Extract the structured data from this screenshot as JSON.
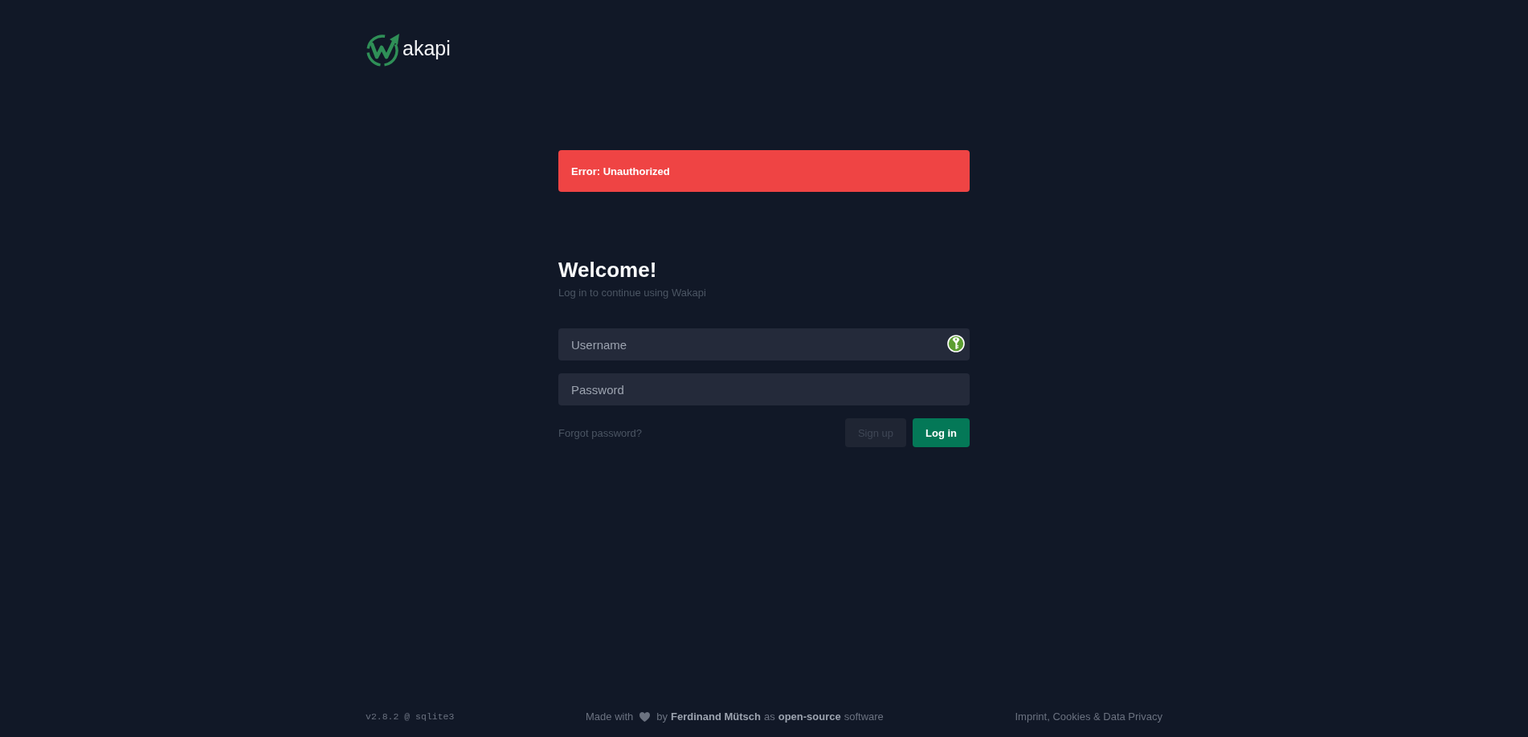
{
  "header": {
    "brand": "akapi"
  },
  "alert": {
    "kind": "error",
    "message": "Error: Unauthorized"
  },
  "login": {
    "title": "Welcome!",
    "subtitle": "Log in to continue using Wakapi",
    "fields": [
      {
        "placeholder": "Username",
        "autofill_icon": true
      },
      {
        "placeholder": "Password",
        "autofill_icon": false
      }
    ],
    "forgot_link": "Forgot password?",
    "buttons": [
      {
        "kind": "secondary",
        "label": "Sign up",
        "disabled": true
      },
      {
        "kind": "primary",
        "label": "Log in",
        "disabled": false
      }
    ]
  },
  "footer": {
    "version": "v2.8.2 @ sqlite3",
    "credit": {
      "lead": "Made with",
      "by": "by",
      "author": "Ferdinand Mütsch",
      "as": "as",
      "project": "open-source",
      "tail": "software"
    },
    "imprint": "Imprint, Cookies & Data Privacy"
  }
}
